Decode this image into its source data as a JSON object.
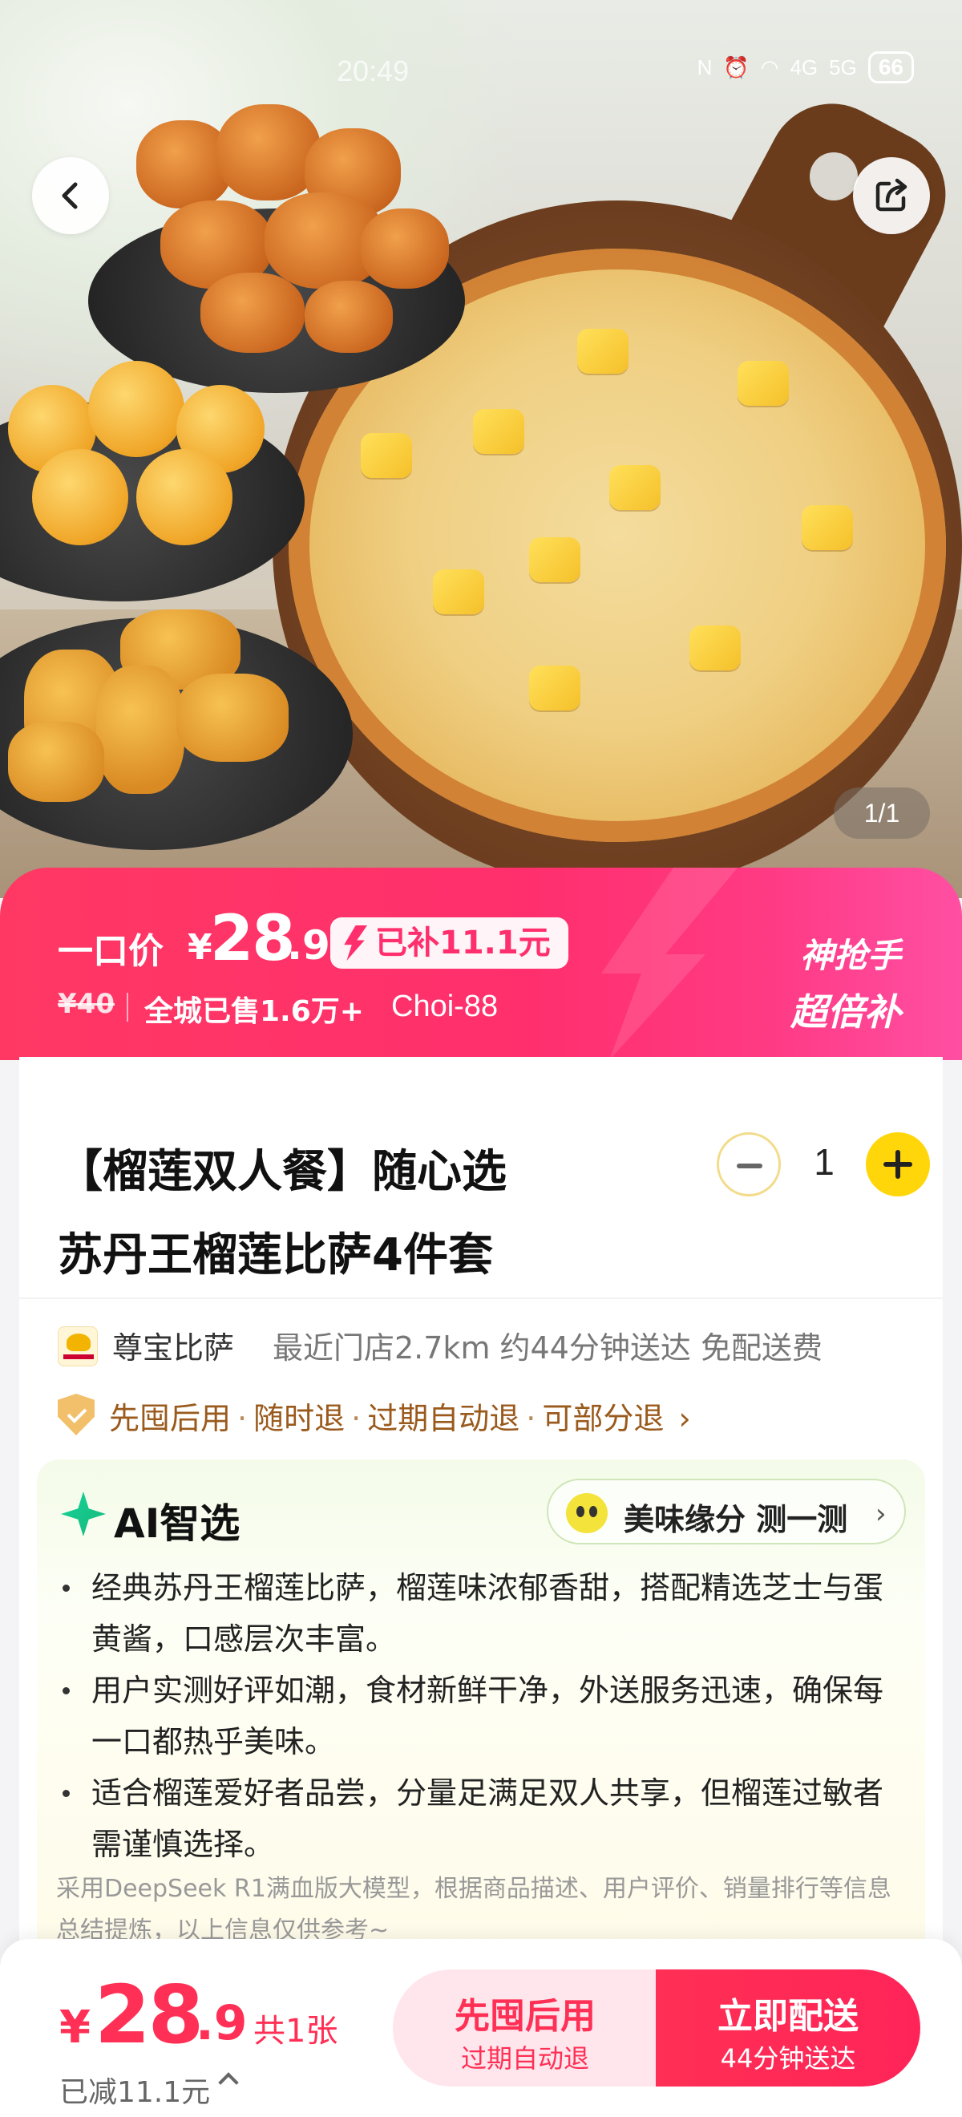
{
  "status_bar": {
    "time": "20:49",
    "battery": "66",
    "network1": "4G",
    "network2": "5G"
  },
  "gallery": {
    "page_indicator": "1/1"
  },
  "promo": {
    "label": "一口价",
    "currency": "¥",
    "price_int": "28",
    "price_dec": ".9",
    "subsidy": "已补11.1元",
    "original_price": "¥40",
    "sold": "全城已售1.6万+",
    "code": "Choi-88",
    "tag_line1": "神抢手",
    "tag_line2": "超倍补",
    "accent_color": "#ff2f6d"
  },
  "product": {
    "title_line1": "【榴莲双人餐】随心选",
    "title_line2": "苏丹王榴莲比萨4件套",
    "quantity": "1"
  },
  "store": {
    "name": "尊宝比萨",
    "meta": "最近门店2.7km  约44分钟送达  免配送费",
    "guarantees": [
      "先囤后用",
      "随时退",
      "过期自动退",
      "可部分退"
    ]
  },
  "ai": {
    "title": "AI智选",
    "taste_button": "美味缘分 测一测",
    "bullets": [
      "经典苏丹王榴莲比萨，榴莲味浓郁香甜，搭配精选芝士与蛋黄酱，口感层次丰富。",
      "用户实测好评如潮，食材新鲜干净，外送服务迅速，确保每一口都热乎美味。",
      "适合榴莲爱好者品尝，分量足满足双人共享，但榴莲过敏者需谨慎选择。"
    ],
    "note": "采用DeepSeek R1满血版大模型，根据商品描述、用户评价、销量排行等信息总结提炼，以上信息仅供参考~"
  },
  "bottom_bar": {
    "currency": "¥",
    "price_int": "28",
    "price_dec": ".9",
    "count": "共1张",
    "reduced": "已减11.1元",
    "cta_left_main": "先囤后用",
    "cta_left_sub": "过期自动退",
    "cta_right_main": "立即配送",
    "cta_right_sub": "44分钟送达",
    "brand_color": "#ff2f55"
  }
}
